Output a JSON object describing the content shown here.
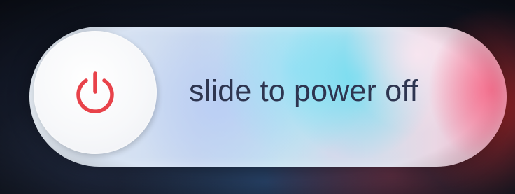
{
  "power_slider": {
    "label": "slide to power off",
    "icon": "power-icon",
    "icon_color": "#e8424a"
  }
}
